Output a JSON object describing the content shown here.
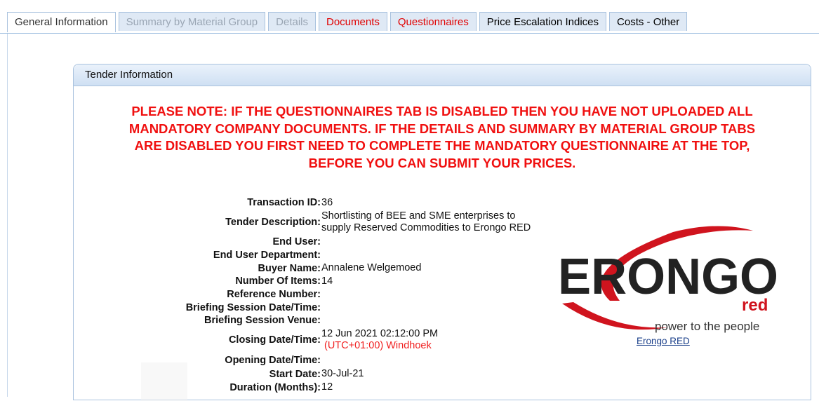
{
  "tabs": [
    {
      "label": "General Information",
      "state": "active"
    },
    {
      "label": "Summary by Material Group",
      "state": "disabled"
    },
    {
      "label": "Details",
      "state": "disabled"
    },
    {
      "label": "Documents",
      "state": "alert"
    },
    {
      "label": "Questionnaires",
      "state": "alert"
    },
    {
      "label": "Price Escalation Indices",
      "state": "normal"
    },
    {
      "label": "Costs - Other",
      "state": "normal"
    }
  ],
  "panel": {
    "title": "Tender Information",
    "notice_lines": [
      "PLEASE NOTE: IF THE QUESTIONNAIRES TAB IS DISABLED THEN YOU HAVE NOT UPLOADED ALL",
      "MANDATORY COMPANY DOCUMENTS. IF THE DETAILS AND SUMMARY BY MATERIAL GROUP TABS",
      "ARE DISABLED YOU FIRST NEED TO COMPLETE THE MANDATORY QUESTIONNAIRE AT THE TOP,",
      "BEFORE YOU CAN SUBMIT YOUR PRICES."
    ]
  },
  "fields": {
    "transaction_id": {
      "label": "Transaction ID:",
      "value": "36"
    },
    "tender_description": {
      "label": "Tender Description:",
      "value_line1": "Shortlisting of BEE and SME enterprises to",
      "value_line2": "supply Reserved Commodities to Erongo RED"
    },
    "end_user": {
      "label": "End User:",
      "value": ""
    },
    "end_user_department": {
      "label": "End User Department:",
      "value": ""
    },
    "buyer_name": {
      "label": "Buyer Name:",
      "value": "Annalene Welgemoed"
    },
    "number_of_items": {
      "label": "Number Of Items:",
      "value": "14"
    },
    "reference_number": {
      "label": "Reference Number:",
      "value": ""
    },
    "briefing_datetime": {
      "label": "Briefing Session Date/Time:",
      "value": ""
    },
    "briefing_venue": {
      "label": "Briefing Session Venue:",
      "value": ""
    },
    "closing_datetime": {
      "label": "Closing Date/Time:",
      "value": "12 Jun 2021 02:12:00 PM",
      "timezone": "(UTC+01:00) Windhoek"
    },
    "opening_datetime": {
      "label": "Opening Date/Time:",
      "value": ""
    },
    "start_date": {
      "label": "Start Date:",
      "value": "30-Jul-21"
    },
    "duration": {
      "label": "Duration (Months):",
      "value": "12"
    }
  },
  "logo": {
    "wordmark": "ERONGO",
    "sub": "red",
    "tagline": "power to the people",
    "link_text": "Erongo RED",
    "brand_color": "#d0141e"
  },
  "colors": {
    "tab_bg": "#dfe9f5",
    "notice": "#f01010",
    "border": "#a9c2de"
  }
}
